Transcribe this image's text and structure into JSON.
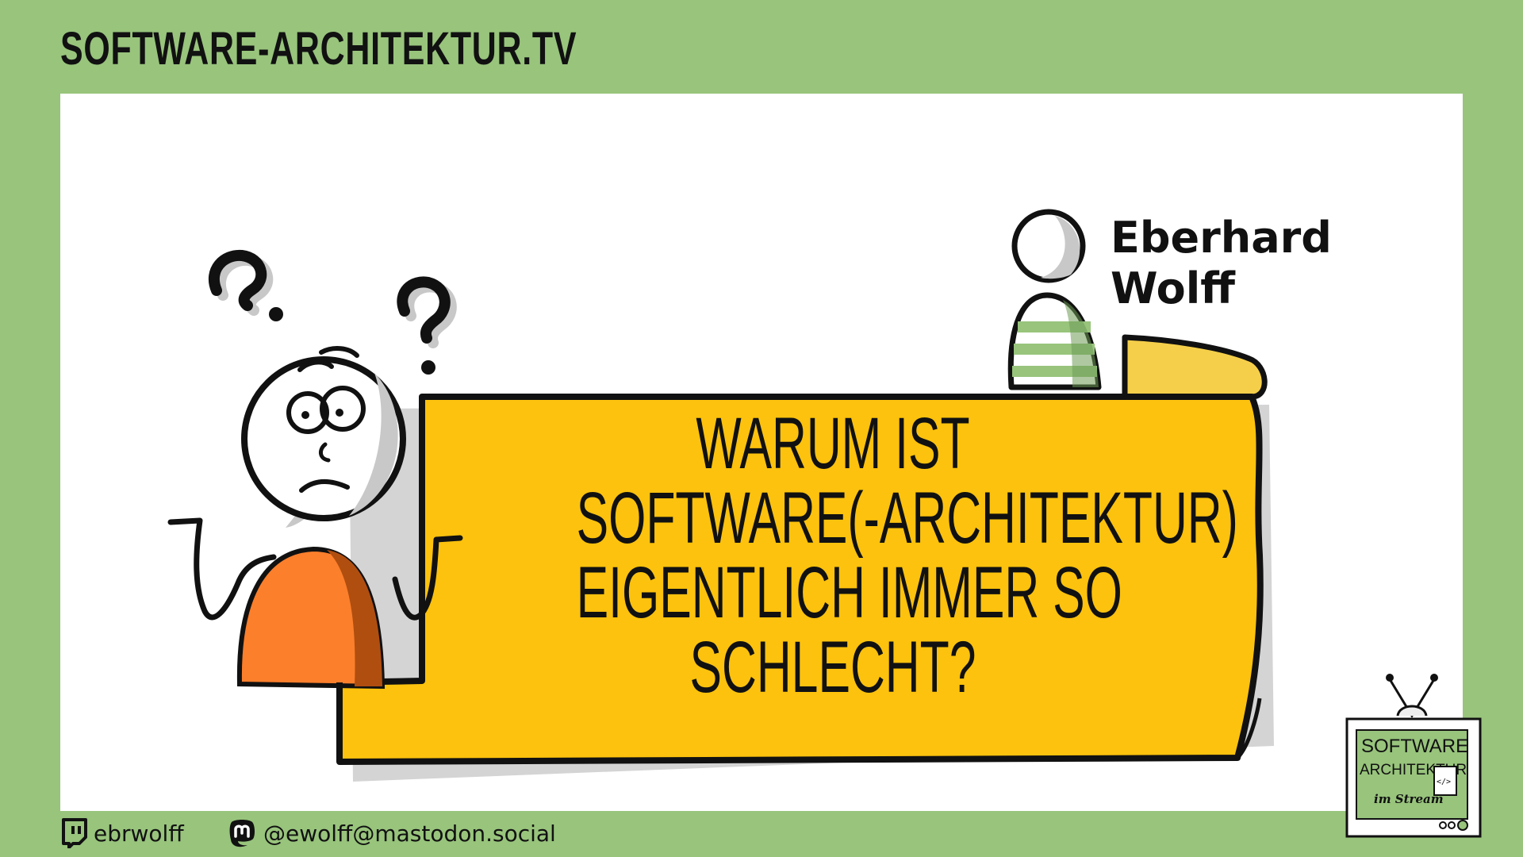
{
  "header": {
    "site_title": "SOFTWARE-ARCHITEKTUR.TV"
  },
  "presenter": {
    "first_name": "Eberhard",
    "last_name": "Wolff"
  },
  "banner": {
    "lines": [
      "WARUM IST",
      "SOFTWARE(-ARCHITEKTUR)",
      "EIGENTLICH IMMER SO",
      "SCHLECHT?"
    ]
  },
  "footer": {
    "twitch_handle": "ebrwolff",
    "mastodon_handle": "@ewolff@mastodon.social",
    "twitch_icon": "twitch-icon",
    "mastodon_icon": "mastodon-icon"
  },
  "logo": {
    "line1": "SOFTWARE",
    "line2": "ARCHITEKTUR",
    "line3": "im Stream",
    "code_glyph": "</>"
  },
  "colors": {
    "background": "#98c47c",
    "banner_yellow": "#fcc20d",
    "banner_curl": "#f6cf4a",
    "shirt_orange": "#fc7f2c",
    "shirt_shade": "#b04e10",
    "stripe_green": "#98c47c"
  }
}
